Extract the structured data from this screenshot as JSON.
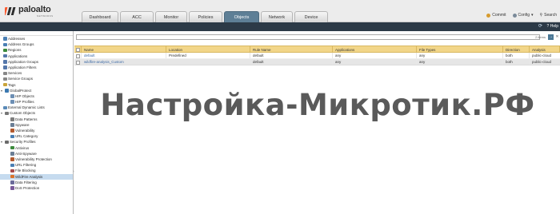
{
  "brand": {
    "name": "paloalto",
    "sub": "NETWORKS"
  },
  "tabs": [
    {
      "label": "Dashboard",
      "active": false
    },
    {
      "label": "ACC",
      "active": false
    },
    {
      "label": "Monitor",
      "active": false
    },
    {
      "label": "Policies",
      "active": false
    },
    {
      "label": "Objects",
      "active": true
    },
    {
      "label": "Network",
      "active": false
    },
    {
      "label": "Device",
      "active": false
    }
  ],
  "header_actions": {
    "commit": "Commit",
    "config": "Config",
    "search": "Search"
  },
  "toolbar": {
    "help": "Help"
  },
  "search": {
    "value": "",
    "count": "2 items"
  },
  "sidebar": {
    "items": [
      {
        "label": "Addresses",
        "level": 0,
        "icon": "address-icon",
        "color": "#4a7fb4"
      },
      {
        "label": "Address Groups",
        "level": 0,
        "icon": "address-group-icon",
        "color": "#4a7fb4"
      },
      {
        "label": "Regions",
        "level": 0,
        "icon": "globe-icon",
        "color": "#3b8a3b"
      },
      {
        "label": "Applications",
        "level": 0,
        "icon": "application-icon",
        "color": "#5577aa"
      },
      {
        "label": "Application Groups",
        "level": 0,
        "icon": "application-group-icon",
        "color": "#5577aa"
      },
      {
        "label": "Application Filters",
        "level": 0,
        "icon": "filter-icon",
        "color": "#5577aa"
      },
      {
        "label": "Services",
        "level": 0,
        "icon": "services-icon",
        "color": "#888888"
      },
      {
        "label": "Service Groups",
        "level": 0,
        "icon": "service-group-icon",
        "color": "#888888"
      },
      {
        "label": "Tags",
        "level": 0,
        "icon": "tag-icon",
        "color": "#c9a43a"
      },
      {
        "label": "GlobalProtect",
        "level": 0,
        "icon": "globalprotect-icon",
        "color": "#3b78b0",
        "expanded": true
      },
      {
        "label": "HIP Objects",
        "level": 1,
        "icon": "hip-icon",
        "color": "#6d8fb4"
      },
      {
        "label": "HIP Profiles",
        "level": 1,
        "icon": "hip-profile-icon",
        "color": "#6d8fb4"
      },
      {
        "label": "External Dynamic Lists",
        "level": 0,
        "icon": "list-icon",
        "color": "#5a8ab8"
      },
      {
        "label": "Custom Objects",
        "level": 0,
        "icon": "custom-objects-icon",
        "color": "#777777",
        "expanded": true
      },
      {
        "label": "Data Patterns",
        "level": 1,
        "icon": "data-pattern-icon",
        "color": "#7d7d7d"
      },
      {
        "label": "Spyware",
        "level": 1,
        "icon": "spyware-icon",
        "color": "#6b7f96"
      },
      {
        "label": "Vulnerability",
        "level": 1,
        "icon": "vulnerability-icon",
        "color": "#b35a2e"
      },
      {
        "label": "URL Category",
        "level": 1,
        "icon": "url-icon",
        "color": "#4a7fb4"
      },
      {
        "label": "Security Profiles",
        "level": 0,
        "icon": "security-profiles-icon",
        "color": "#6a6a6a",
        "expanded": true
      },
      {
        "label": "Antivirus",
        "level": 1,
        "icon": "antivirus-icon",
        "color": "#3c8a3c"
      },
      {
        "label": "Anti-Spyware",
        "level": 1,
        "icon": "anti-spyware-icon",
        "color": "#6b7f96"
      },
      {
        "label": "Vulnerability Protection",
        "level": 1,
        "icon": "vulnerability-protection-icon",
        "color": "#b35a2e"
      },
      {
        "label": "URL Filtering",
        "level": 1,
        "icon": "url-filtering-icon",
        "color": "#4a7fb4"
      },
      {
        "label": "File Blocking",
        "level": 1,
        "icon": "file-blocking-icon",
        "color": "#a84a4a"
      },
      {
        "label": "WildFire Analysis",
        "level": 1,
        "icon": "wildfire-icon",
        "color": "#d9722b",
        "selected": true
      },
      {
        "label": "Data Filtering",
        "level": 1,
        "icon": "data-filtering-icon",
        "color": "#6a6a9a"
      },
      {
        "label": "DoS Protection",
        "level": 1,
        "icon": "dos-icon",
        "color": "#7a5a9a"
      }
    ]
  },
  "table": {
    "columns": [
      "Name",
      "Location",
      "Rule Name",
      "Applications",
      "File Types",
      "Direction",
      "Analysis"
    ],
    "rows": [
      [
        "default",
        "Predefined",
        "default",
        "any",
        "any",
        "both",
        "public-cloud"
      ],
      [
        "wildfire-analysis_Custom",
        "",
        "default",
        "any",
        "any",
        "both",
        "public-cloud"
      ]
    ]
  },
  "watermark": "Настройка-Микротик.РФ"
}
